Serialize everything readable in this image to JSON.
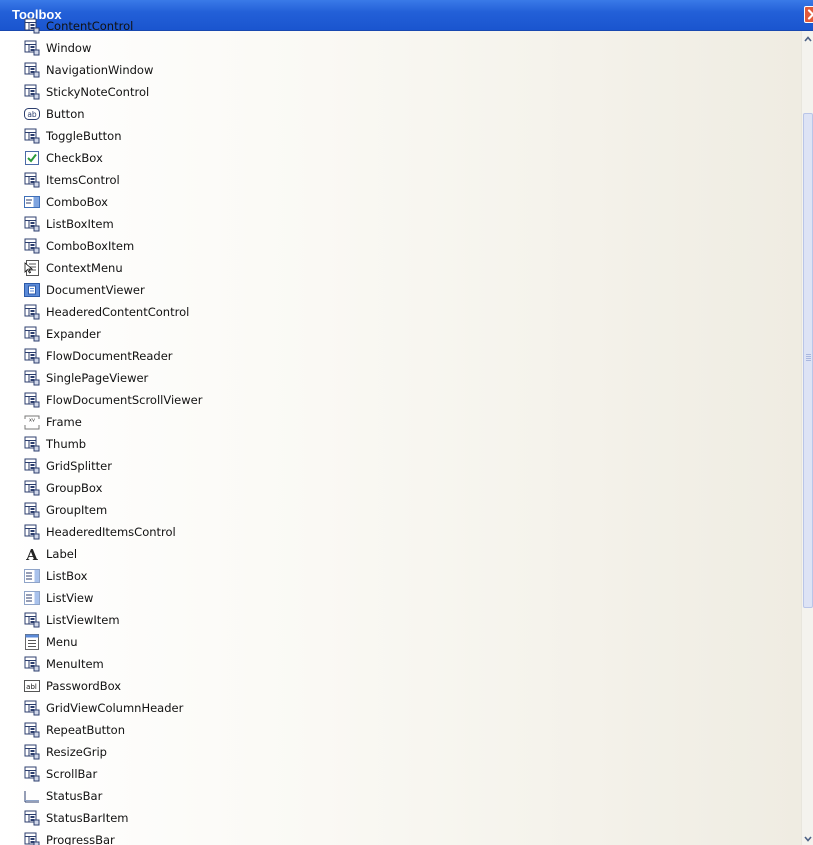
{
  "window": {
    "title": "Toolbox"
  },
  "colors": {
    "titlebar": "#2360d8",
    "close": "#e25a3a"
  },
  "items": [
    {
      "label": "ContentControl",
      "icon": "generic-control-icon"
    },
    {
      "label": "Window",
      "icon": "generic-control-icon"
    },
    {
      "label": "NavigationWindow",
      "icon": "generic-control-icon"
    },
    {
      "label": "StickyNoteControl",
      "icon": "generic-control-icon"
    },
    {
      "label": "Button",
      "icon": "button-icon"
    },
    {
      "label": "ToggleButton",
      "icon": "generic-control-icon"
    },
    {
      "label": "CheckBox",
      "icon": "checkbox-icon"
    },
    {
      "label": "ItemsControl",
      "icon": "generic-control-icon"
    },
    {
      "label": "ComboBox",
      "icon": "combobox-icon"
    },
    {
      "label": "ListBoxItem",
      "icon": "generic-control-icon"
    },
    {
      "label": "ComboBoxItem",
      "icon": "generic-control-icon"
    },
    {
      "label": "ContextMenu",
      "icon": "context-menu-icon"
    },
    {
      "label": "DocumentViewer",
      "icon": "document-viewer-icon"
    },
    {
      "label": "HeaderedContentControl",
      "icon": "generic-control-icon"
    },
    {
      "label": "Expander",
      "icon": "generic-control-icon"
    },
    {
      "label": "FlowDocumentReader",
      "icon": "generic-control-icon"
    },
    {
      "label": "SinglePageViewer",
      "icon": "generic-control-icon"
    },
    {
      "label": "FlowDocumentScrollViewer",
      "icon": "generic-control-icon"
    },
    {
      "label": "Frame",
      "icon": "frame-icon"
    },
    {
      "label": "Thumb",
      "icon": "generic-control-icon"
    },
    {
      "label": "GridSplitter",
      "icon": "generic-control-icon"
    },
    {
      "label": "GroupBox",
      "icon": "generic-control-icon"
    },
    {
      "label": "GroupItem",
      "icon": "generic-control-icon"
    },
    {
      "label": "HeaderedItemsControl",
      "icon": "generic-control-icon"
    },
    {
      "label": "Label",
      "icon": "label-icon"
    },
    {
      "label": "ListBox",
      "icon": "listbox-icon"
    },
    {
      "label": "ListView",
      "icon": "listbox-icon"
    },
    {
      "label": "ListViewItem",
      "icon": "generic-control-icon"
    },
    {
      "label": "Menu",
      "icon": "menu-icon"
    },
    {
      "label": "MenuItem",
      "icon": "generic-control-icon"
    },
    {
      "label": "PasswordBox",
      "icon": "password-box-icon"
    },
    {
      "label": "GridViewColumnHeader",
      "icon": "generic-control-icon"
    },
    {
      "label": "RepeatButton",
      "icon": "generic-control-icon"
    },
    {
      "label": "ResizeGrip",
      "icon": "generic-control-icon"
    },
    {
      "label": "ScrollBar",
      "icon": "generic-control-icon"
    },
    {
      "label": "StatusBar",
      "icon": "statusbar-icon"
    },
    {
      "label": "StatusBarItem",
      "icon": "generic-control-icon"
    },
    {
      "label": "ProgressBar",
      "icon": "generic-control-icon"
    }
  ]
}
